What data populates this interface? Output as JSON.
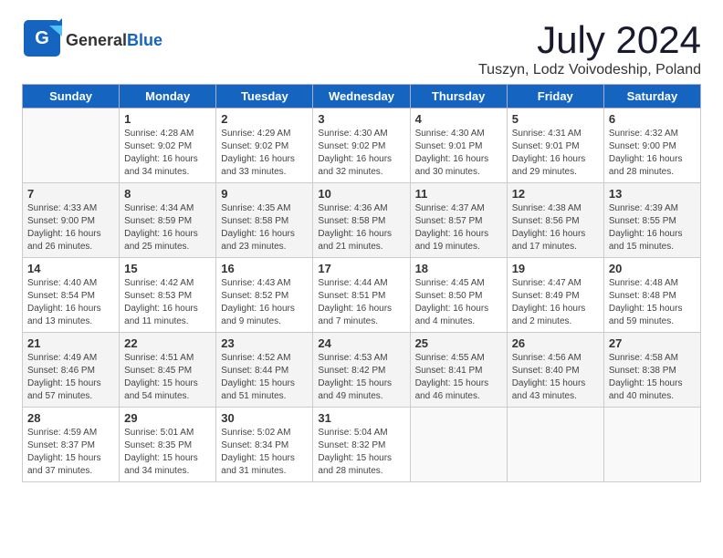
{
  "header": {
    "logo_general": "General",
    "logo_blue": "Blue",
    "title": "July 2024",
    "subtitle": "Tuszyn, Lodz Voivodeship, Poland"
  },
  "days_of_week": [
    "Sunday",
    "Monday",
    "Tuesday",
    "Wednesday",
    "Thursday",
    "Friday",
    "Saturday"
  ],
  "weeks": [
    [
      {
        "day": "",
        "content": ""
      },
      {
        "day": "1",
        "content": "Sunrise: 4:28 AM\nSunset: 9:02 PM\nDaylight: 16 hours\nand 34 minutes."
      },
      {
        "day": "2",
        "content": "Sunrise: 4:29 AM\nSunset: 9:02 PM\nDaylight: 16 hours\nand 33 minutes."
      },
      {
        "day": "3",
        "content": "Sunrise: 4:30 AM\nSunset: 9:02 PM\nDaylight: 16 hours\nand 32 minutes."
      },
      {
        "day": "4",
        "content": "Sunrise: 4:30 AM\nSunset: 9:01 PM\nDaylight: 16 hours\nand 30 minutes."
      },
      {
        "day": "5",
        "content": "Sunrise: 4:31 AM\nSunset: 9:01 PM\nDaylight: 16 hours\nand 29 minutes."
      },
      {
        "day": "6",
        "content": "Sunrise: 4:32 AM\nSunset: 9:00 PM\nDaylight: 16 hours\nand 28 minutes."
      }
    ],
    [
      {
        "day": "7",
        "content": "Sunrise: 4:33 AM\nSunset: 9:00 PM\nDaylight: 16 hours\nand 26 minutes."
      },
      {
        "day": "8",
        "content": "Sunrise: 4:34 AM\nSunset: 8:59 PM\nDaylight: 16 hours\nand 25 minutes."
      },
      {
        "day": "9",
        "content": "Sunrise: 4:35 AM\nSunset: 8:58 PM\nDaylight: 16 hours\nand 23 minutes."
      },
      {
        "day": "10",
        "content": "Sunrise: 4:36 AM\nSunset: 8:58 PM\nDaylight: 16 hours\nand 21 minutes."
      },
      {
        "day": "11",
        "content": "Sunrise: 4:37 AM\nSunset: 8:57 PM\nDaylight: 16 hours\nand 19 minutes."
      },
      {
        "day": "12",
        "content": "Sunrise: 4:38 AM\nSunset: 8:56 PM\nDaylight: 16 hours\nand 17 minutes."
      },
      {
        "day": "13",
        "content": "Sunrise: 4:39 AM\nSunset: 8:55 PM\nDaylight: 16 hours\nand 15 minutes."
      }
    ],
    [
      {
        "day": "14",
        "content": "Sunrise: 4:40 AM\nSunset: 8:54 PM\nDaylight: 16 hours\nand 13 minutes."
      },
      {
        "day": "15",
        "content": "Sunrise: 4:42 AM\nSunset: 8:53 PM\nDaylight: 16 hours\nand 11 minutes."
      },
      {
        "day": "16",
        "content": "Sunrise: 4:43 AM\nSunset: 8:52 PM\nDaylight: 16 hours\nand 9 minutes."
      },
      {
        "day": "17",
        "content": "Sunrise: 4:44 AM\nSunset: 8:51 PM\nDaylight: 16 hours\nand 7 minutes."
      },
      {
        "day": "18",
        "content": "Sunrise: 4:45 AM\nSunset: 8:50 PM\nDaylight: 16 hours\nand 4 minutes."
      },
      {
        "day": "19",
        "content": "Sunrise: 4:47 AM\nSunset: 8:49 PM\nDaylight: 16 hours\nand 2 minutes."
      },
      {
        "day": "20",
        "content": "Sunrise: 4:48 AM\nSunset: 8:48 PM\nDaylight: 15 hours\nand 59 minutes."
      }
    ],
    [
      {
        "day": "21",
        "content": "Sunrise: 4:49 AM\nSunset: 8:46 PM\nDaylight: 15 hours\nand 57 minutes."
      },
      {
        "day": "22",
        "content": "Sunrise: 4:51 AM\nSunset: 8:45 PM\nDaylight: 15 hours\nand 54 minutes."
      },
      {
        "day": "23",
        "content": "Sunrise: 4:52 AM\nSunset: 8:44 PM\nDaylight: 15 hours\nand 51 minutes."
      },
      {
        "day": "24",
        "content": "Sunrise: 4:53 AM\nSunset: 8:42 PM\nDaylight: 15 hours\nand 49 minutes."
      },
      {
        "day": "25",
        "content": "Sunrise: 4:55 AM\nSunset: 8:41 PM\nDaylight: 15 hours\nand 46 minutes."
      },
      {
        "day": "26",
        "content": "Sunrise: 4:56 AM\nSunset: 8:40 PM\nDaylight: 15 hours\nand 43 minutes."
      },
      {
        "day": "27",
        "content": "Sunrise: 4:58 AM\nSunset: 8:38 PM\nDaylight: 15 hours\nand 40 minutes."
      }
    ],
    [
      {
        "day": "28",
        "content": "Sunrise: 4:59 AM\nSunset: 8:37 PM\nDaylight: 15 hours\nand 37 minutes."
      },
      {
        "day": "29",
        "content": "Sunrise: 5:01 AM\nSunset: 8:35 PM\nDaylight: 15 hours\nand 34 minutes."
      },
      {
        "day": "30",
        "content": "Sunrise: 5:02 AM\nSunset: 8:34 PM\nDaylight: 15 hours\nand 31 minutes."
      },
      {
        "day": "31",
        "content": "Sunrise: 5:04 AM\nSunset: 8:32 PM\nDaylight: 15 hours\nand 28 minutes."
      },
      {
        "day": "",
        "content": ""
      },
      {
        "day": "",
        "content": ""
      },
      {
        "day": "",
        "content": ""
      }
    ]
  ]
}
